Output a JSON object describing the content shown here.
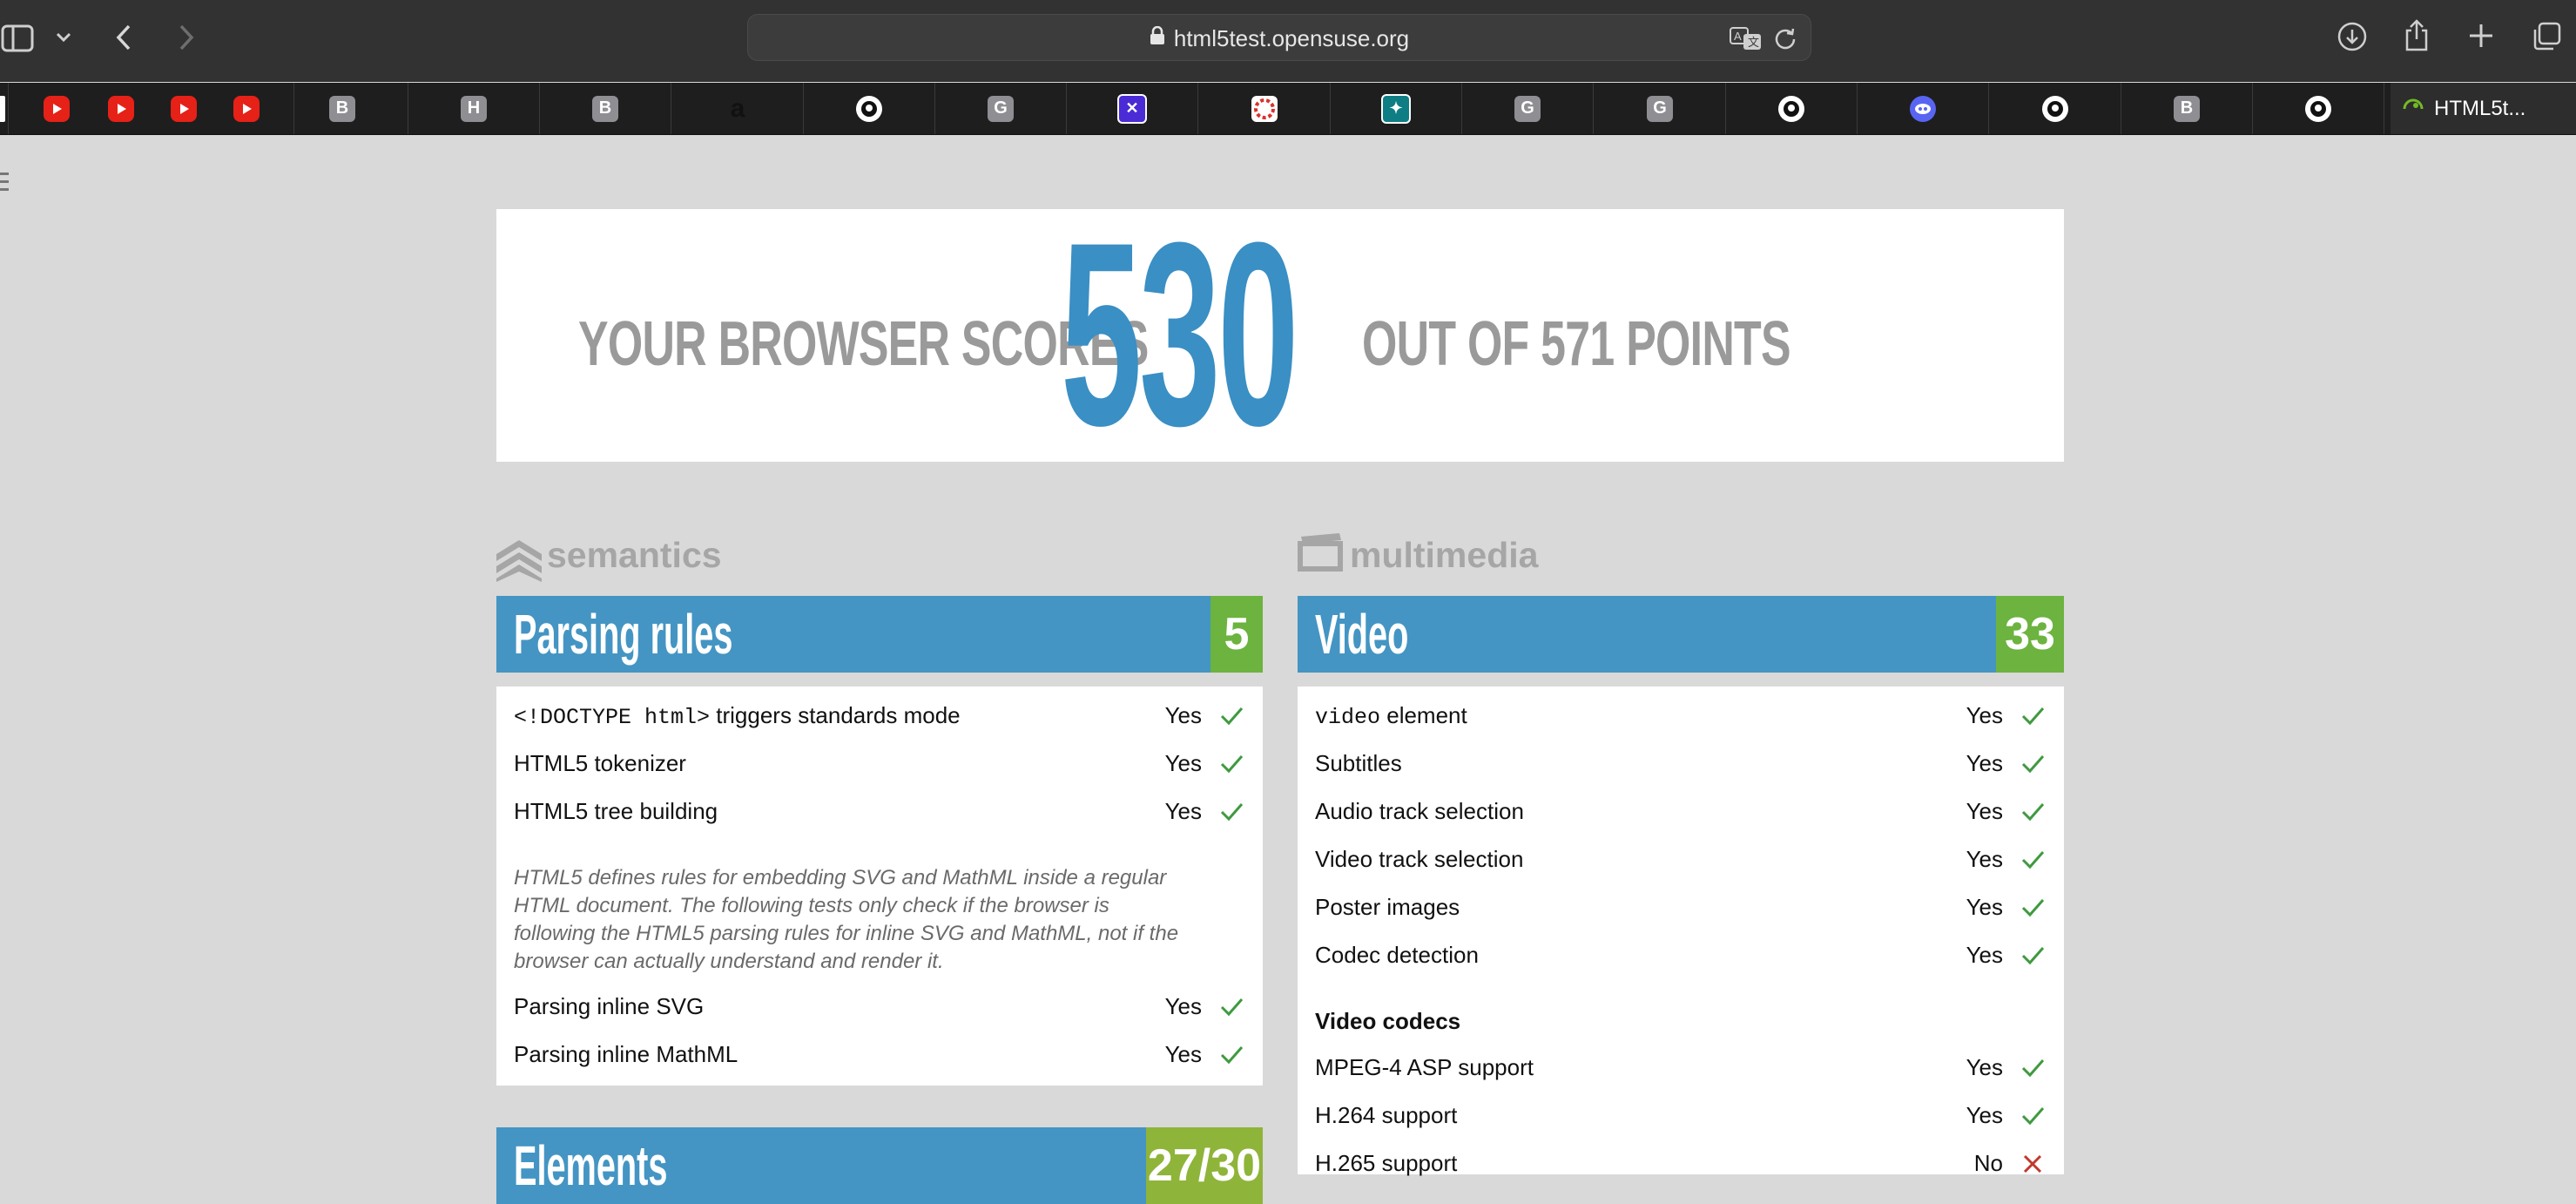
{
  "browser": {
    "url": "html5test.opensuse.org",
    "active_tab_label": "HTML5t...",
    "tab_favicons": [
      "youtube-icon",
      "youtube-icon",
      "youtube-icon",
      "youtube-icon",
      "B",
      "H",
      "B",
      "a",
      "github-icon",
      "G",
      "app-icon",
      "app-icon",
      "app-icon",
      "G",
      "G",
      "github-icon",
      "discord-icon",
      "github-icon",
      "B",
      "github-icon"
    ]
  },
  "score": {
    "prefix": "YOUR BROWSER SCORES",
    "value": "530",
    "suffix": "OUT OF 571 POINTS"
  },
  "sections": {
    "left_label": "semantics",
    "right_label": "multimedia"
  },
  "parsing_rules": {
    "title": "Parsing rules",
    "score": "5",
    "rows": [
      {
        "code": "<!DOCTYPE html>",
        "label": " triggers standards mode",
        "result": "Yes"
      },
      {
        "label": "HTML5 tokenizer",
        "result": "Yes"
      },
      {
        "label": "HTML5 tree building",
        "result": "Yes"
      }
    ],
    "note": "HTML5 defines rules for embedding SVG and MathML inside a regular HTML document. The following tests only check if the browser is following the HTML5 parsing rules for inline SVG and MathML, not if the browser can actually understand and render it.",
    "rows2": [
      {
        "label": "Parsing inline SVG",
        "result": "Yes"
      },
      {
        "label": "Parsing inline MathML",
        "result": "Yes"
      }
    ]
  },
  "elements": {
    "title": "Elements",
    "score": "27/30"
  },
  "video": {
    "title": "Video",
    "score": "33",
    "rows": [
      {
        "code": "video",
        "label": " element",
        "result": "Yes"
      },
      {
        "label": "Subtitles",
        "result": "Yes"
      },
      {
        "label": "Audio track selection",
        "result": "Yes"
      },
      {
        "label": "Video track selection",
        "result": "Yes"
      },
      {
        "label": "Poster images",
        "result": "Yes"
      },
      {
        "label": "Codec detection",
        "result": "Yes"
      }
    ],
    "codecs_heading": "Video codecs",
    "codec_rows": [
      {
        "label": "MPEG-4 ASP support",
        "result": "Yes"
      },
      {
        "label": "H.264 support",
        "result": "Yes"
      },
      {
        "label": "H.265 support",
        "result": "No"
      }
    ]
  },
  "colors": {
    "accent_blue": "#4495c3",
    "score_green": "#6cb33f",
    "check_green": "#3f9a3f",
    "cross_red": "#c0392b"
  }
}
